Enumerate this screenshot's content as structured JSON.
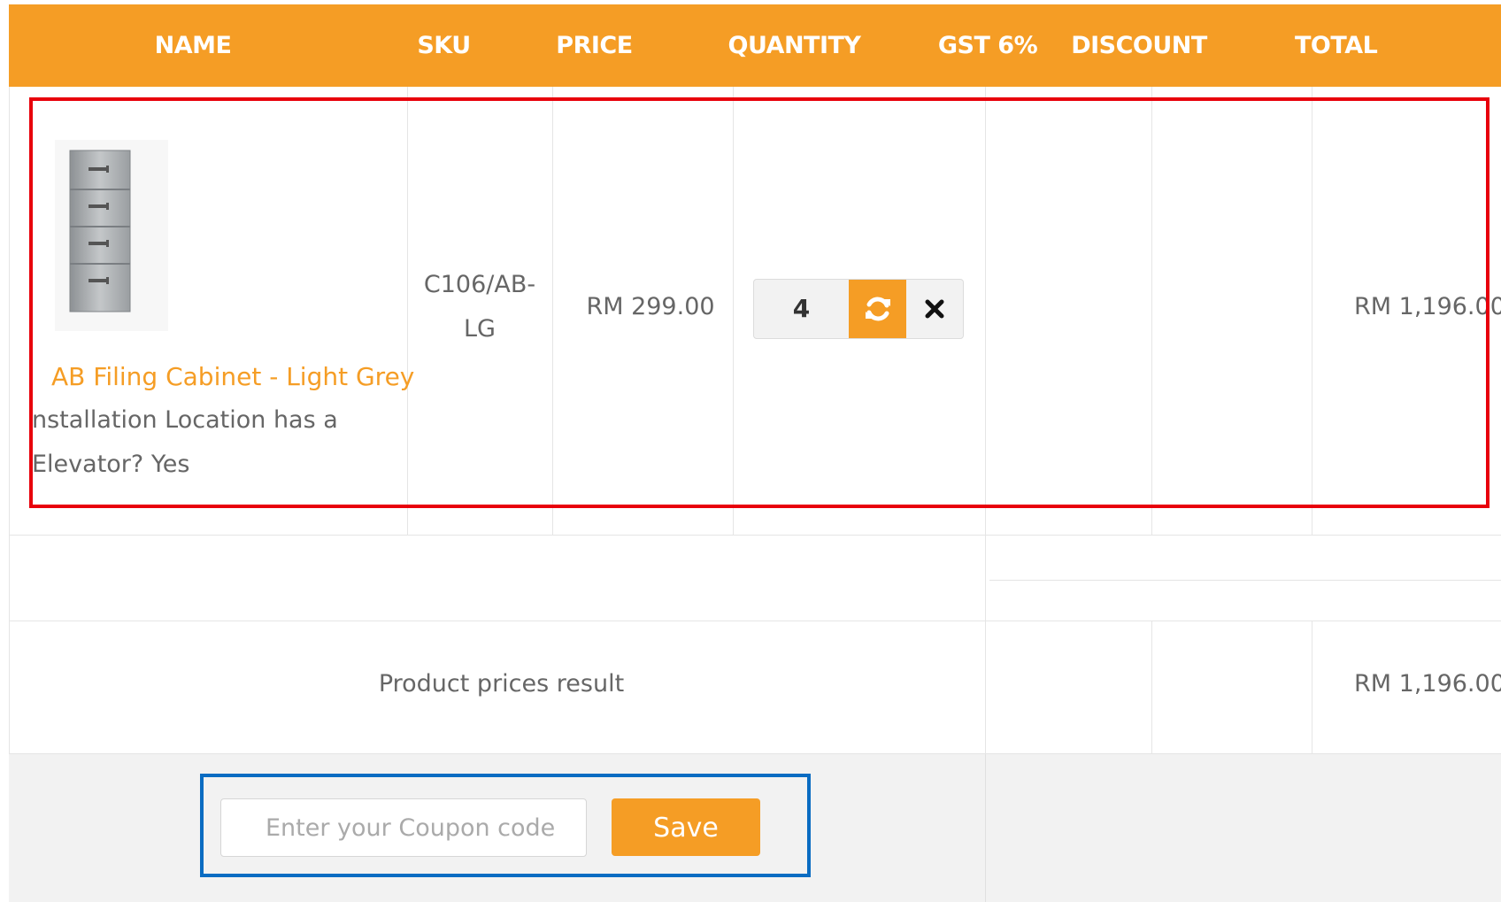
{
  "columns": {
    "name": "NAME",
    "sku": "SKU",
    "price": "PRICE",
    "quantity": "QUANTITY",
    "gst": "GST 6%",
    "discount": "DISCOUNT",
    "total": "TOTAL"
  },
  "item": {
    "image_icon": "filing-cabinet-image",
    "name": "AB Filing Cabinet - Light Grey",
    "option_line1": "nstallation Location has a",
    "option_line2": "Elevator? Yes",
    "sku_line1": "C106/AB-",
    "sku_line2": "LG",
    "price": "RM 299.00",
    "quantity": "4",
    "refresh_icon": "refresh-icon",
    "remove_icon": "close-icon",
    "total": "RM 1,196.00"
  },
  "summary": {
    "label": "Product prices result",
    "total": "RM 1,196.00"
  },
  "coupon": {
    "placeholder": "Enter your Coupon code",
    "save_label": "Save"
  },
  "colors": {
    "accent": "#f59d25",
    "highlight_red": "#e8000b",
    "highlight_blue": "#0a6cc2"
  }
}
